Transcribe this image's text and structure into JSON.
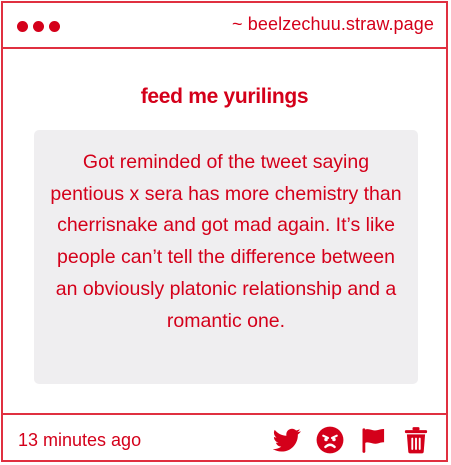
{
  "header": {
    "site": "~ beelzechuu.straw.page"
  },
  "prompt": "feed me yurilings",
  "message": "Got reminded of the tweet saying pentious x sera has more chemistry than cherrisnake and got mad again. It’s like people can’t tell the difference between an obviously platonic relationship and a romantic one.",
  "footer": {
    "timestamp": "13 minutes ago",
    "actions": [
      "twitter-icon",
      "angry-face-icon",
      "flag-icon",
      "trash-icon"
    ]
  },
  "colors": {
    "accent": "#d4001a",
    "border": "#e03040",
    "message_bg": "#efeef0"
  }
}
